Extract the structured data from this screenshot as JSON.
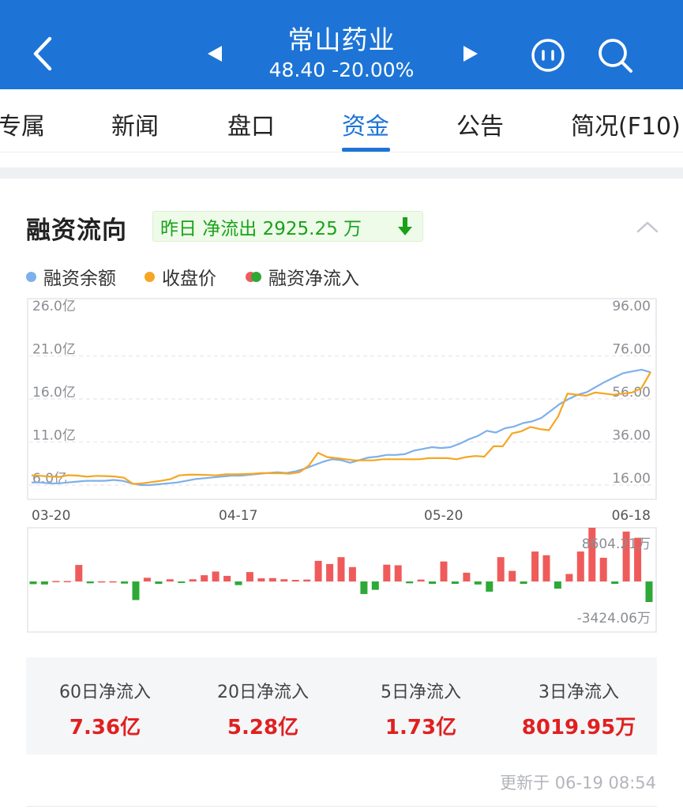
{
  "header": {
    "stock_name": "常山药业",
    "price_change": "48.40 -20.00%",
    "colors": {
      "bar": "#1d74d6",
      "text": "#ffffff"
    }
  },
  "tabs": [
    {
      "label": "专属",
      "active": false
    },
    {
      "label": "新闻",
      "active": false
    },
    {
      "label": "盘口",
      "active": false
    },
    {
      "label": "资金",
      "active": true
    },
    {
      "label": "公告",
      "active": false
    },
    {
      "label": "简况(F10)",
      "active": false
    }
  ],
  "section": {
    "title": "融资流向",
    "badge_text": "昨日 净流出 2925.25 万",
    "badge_icon": "down-arrow-icon",
    "collapse_icon": "chevron-up-icon"
  },
  "legend": [
    {
      "label": "融资余额",
      "color": "#7eb0ea"
    },
    {
      "label": "收盘价",
      "color": "#f5a623"
    },
    {
      "label": "融资净流入",
      "colors": [
        "#ef5b5b",
        "#2ea836"
      ]
    }
  ],
  "chart_data": [
    {
      "type": "line",
      "x_ticks": [
        "03-20",
        "04-17",
        "05-20",
        "06-18"
      ],
      "left_axis_ticks": [
        "26.0亿",
        "21.0亿",
        "16.0亿",
        "11.0亿",
        "6.0亿"
      ],
      "right_axis_ticks": [
        "96.00",
        "76.00",
        "56.00",
        "36.00",
        "16.00"
      ],
      "ylim_left": [
        6.0,
        26.0
      ],
      "ylim_right": [
        16.0,
        96.0
      ],
      "series": [
        {
          "name": "融资余额",
          "axis": "left",
          "color": "#7eb0ea",
          "values": [
            6.3,
            6.3,
            6.2,
            6.2,
            6.3,
            6.4,
            6.5,
            6.5,
            6.5,
            6.6,
            6.5,
            6.2,
            6.0,
            6.0,
            6.1,
            6.2,
            6.3,
            6.5,
            6.7,
            6.8,
            6.9,
            7.0,
            7.1,
            7.1,
            7.2,
            7.3,
            7.4,
            7.5,
            7.4,
            7.6,
            7.9,
            8.3,
            8.7,
            9.0,
            8.9,
            8.6,
            8.9,
            9.2,
            9.3,
            9.5,
            9.5,
            9.6,
            10.0,
            10.2,
            10.4,
            10.3,
            10.4,
            10.8,
            11.3,
            11.7,
            12.3,
            12.1,
            12.6,
            12.8,
            13.2,
            13.4,
            13.8,
            14.6,
            15.4,
            16.0,
            16.5,
            16.8,
            17.4,
            18.0,
            18.5,
            19.0,
            19.2,
            19.4,
            19.1
          ]
        },
        {
          "name": "收盘价",
          "axis": "right",
          "color": "#f5a623",
          "values": [
            20.5,
            20.3,
            20.0,
            19.8,
            20.6,
            20.4,
            19.9,
            20.3,
            20.2,
            20.0,
            19.4,
            16.5,
            16.8,
            17.4,
            18.0,
            18.7,
            20.5,
            20.8,
            20.8,
            20.7,
            20.5,
            21.0,
            21.0,
            21.1,
            21.3,
            21.6,
            21.5,
            21.5,
            21.3,
            22.0,
            25.0,
            31.0,
            29.0,
            28.5,
            28.0,
            27.5,
            27.5,
            27.5,
            28.0,
            28.0,
            28.0,
            28.0,
            28.0,
            28.5,
            28.5,
            28.5,
            28.0,
            29.0,
            29.5,
            29.2,
            34.0,
            34.0,
            40.0,
            41.0,
            43.0,
            42.0,
            41.5,
            48.0,
            58.5,
            58.0,
            57.5,
            59.0,
            58.5,
            58.0,
            58.5,
            59.0,
            61.0,
            68.5
          ]
        }
      ]
    },
    {
      "type": "bar",
      "series_name": "融资净流入",
      "max_label": "8604.21万",
      "min_label": "-3424.06万",
      "ylim": [
        -3424.06,
        8604.21
      ],
      "colors": {
        "positive": "#ef5b5b",
        "negative": "#2ea836"
      },
      "values": [
        -450,
        -500,
        80,
        60,
        2650,
        -300,
        20,
        30,
        -350,
        -3100,
        600,
        -400,
        350,
        -250,
        350,
        1000,
        1600,
        900,
        -600,
        1500,
        500,
        550,
        350,
        250,
        300,
        3300,
        2800,
        3900,
        2300,
        -2100,
        -1400,
        2700,
        2600,
        -300,
        300,
        -400,
        3200,
        -400,
        1400,
        -500,
        -1700,
        3900,
        1700,
        -400,
        4800,
        4200,
        -1200,
        1200,
        4800,
        8604,
        3800,
        -400,
        8000,
        7000,
        -3424
      ]
    }
  ],
  "stats": [
    {
      "label": "60日净流入",
      "value": "7.36亿"
    },
    {
      "label": "20日净流入",
      "value": "5.28亿"
    },
    {
      "label": "5日净流入",
      "value": "1.73亿"
    },
    {
      "label": "3日净流入",
      "value": "8019.95万"
    }
  ],
  "updated_text": "更新于 06-19 08:54"
}
